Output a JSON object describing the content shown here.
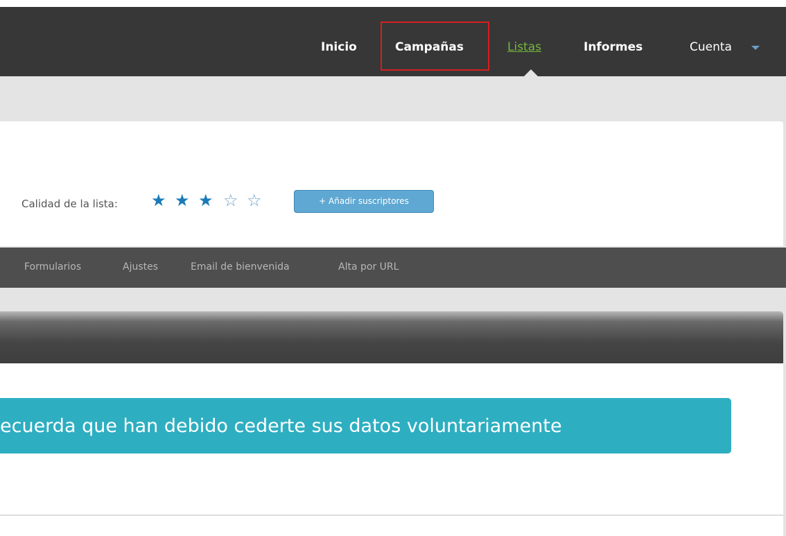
{
  "nav": {
    "items": [
      {
        "label": "Inicio"
      },
      {
        "label": "Campañas"
      },
      {
        "label": "Listas"
      },
      {
        "label": "Informes"
      },
      {
        "label": "Cuenta"
      }
    ],
    "active": "Listas",
    "active_color": "#74b83a"
  },
  "list_header": {
    "quality_label": "Calidad de la lista:",
    "quality_rating": 3,
    "quality_max": 5,
    "stars": [
      "★",
      "★",
      "★",
      "☆",
      "☆"
    ],
    "add_button_label": "+ Añadir suscriptores"
  },
  "subnav": {
    "items": [
      {
        "label": "Formularios"
      },
      {
        "label": "Ajustes"
      },
      {
        "label": "Email de bienvenida"
      },
      {
        "label": "Alta por URL"
      }
    ]
  },
  "banner": {
    "text": "ecuerda que han debido cederte sus datos voluntariamente",
    "color": "#2eaec1"
  },
  "colors": {
    "topbar": "#373737",
    "highlight": "#d42020",
    "star": "#1a7ab8",
    "button": "#5fa8d3"
  }
}
